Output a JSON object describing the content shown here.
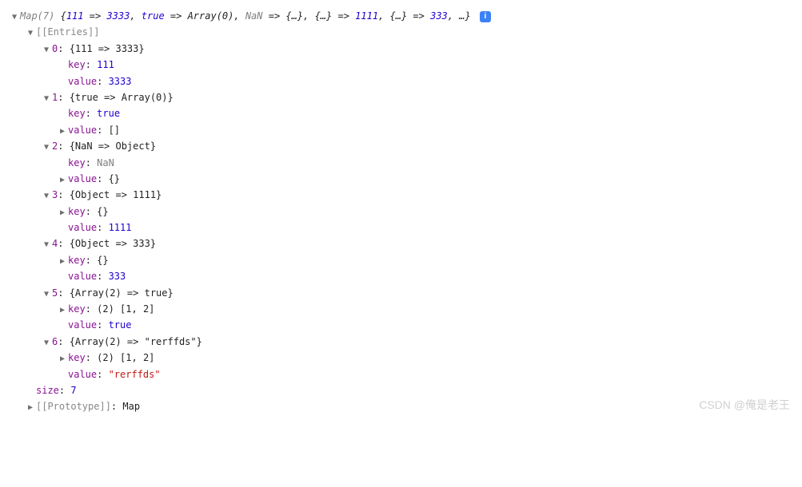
{
  "header": {
    "type_label": "Map(7)",
    "preview_open": "{",
    "preview_items": [
      {
        "k": "111",
        "kcls": "blue",
        "v": "3333",
        "vcls": "blue"
      },
      {
        "k": "true",
        "kcls": "bool",
        "v": "Array(0)",
        "vcls": "black"
      },
      {
        "k": "NaN",
        "kcls": "nan",
        "v": "{…}",
        "vcls": "black"
      },
      {
        "k": "{…}",
        "kcls": "black",
        "v": "1111",
        "vcls": "blue"
      },
      {
        "k": "{…}",
        "kcls": "black",
        "v": "333",
        "vcls": "blue"
      }
    ],
    "preview_more": "…",
    "preview_close": "}",
    "arrow_symbol": " => ",
    "info_glyph": "i"
  },
  "entries_label": "[[Entries]]",
  "entries": [
    {
      "idx": "0",
      "summary": "{111 => 3333}",
      "key_label": "key",
      "key_val": "111",
      "key_cls": "blue",
      "key_expand": false,
      "val_label": "value",
      "val_val": "3333",
      "val_cls": "blue",
      "val_expand": false
    },
    {
      "idx": "1",
      "summary": "{true => Array(0)}",
      "key_label": "key",
      "key_val": "true",
      "key_cls": "bool",
      "key_expand": false,
      "val_label": "value",
      "val_val": "[]",
      "val_cls": "black",
      "val_expand": true
    },
    {
      "idx": "2",
      "summary": "{NaN => Object}",
      "key_label": "key",
      "key_val": "NaN",
      "key_cls": "nan",
      "key_expand": false,
      "val_label": "value",
      "val_val": "{}",
      "val_cls": "black",
      "val_expand": true
    },
    {
      "idx": "3",
      "summary": "{Object => 1111}",
      "key_label": "key",
      "key_val": "{}",
      "key_cls": "black",
      "key_expand": true,
      "val_label": "value",
      "val_val": "1111",
      "val_cls": "blue",
      "val_expand": false
    },
    {
      "idx": "4",
      "summary": "{Object => 333}",
      "key_label": "key",
      "key_val": "{}",
      "key_cls": "black",
      "key_expand": true,
      "val_label": "value",
      "val_val": "333",
      "val_cls": "blue",
      "val_expand": false
    },
    {
      "idx": "5",
      "summary": "{Array(2) => true}",
      "key_label": "key",
      "key_val": "(2) [1, 2]",
      "key_cls": "black",
      "key_expand": true,
      "val_label": "value",
      "val_val": "true",
      "val_cls": "bool",
      "val_expand": false
    },
    {
      "idx": "6",
      "summary": "{Array(2) => \"rerffds\"}",
      "key_label": "key",
      "key_val": "(2) [1, 2]",
      "key_cls": "black",
      "key_expand": true,
      "val_label": "value",
      "val_val": "\"rerffds\"",
      "val_cls": "string",
      "val_expand": false
    }
  ],
  "size": {
    "label": "size",
    "value": "7"
  },
  "prototype": {
    "label": "[[Prototype]]",
    "value": "Map"
  },
  "watermark": "CSDN @俺是老王"
}
